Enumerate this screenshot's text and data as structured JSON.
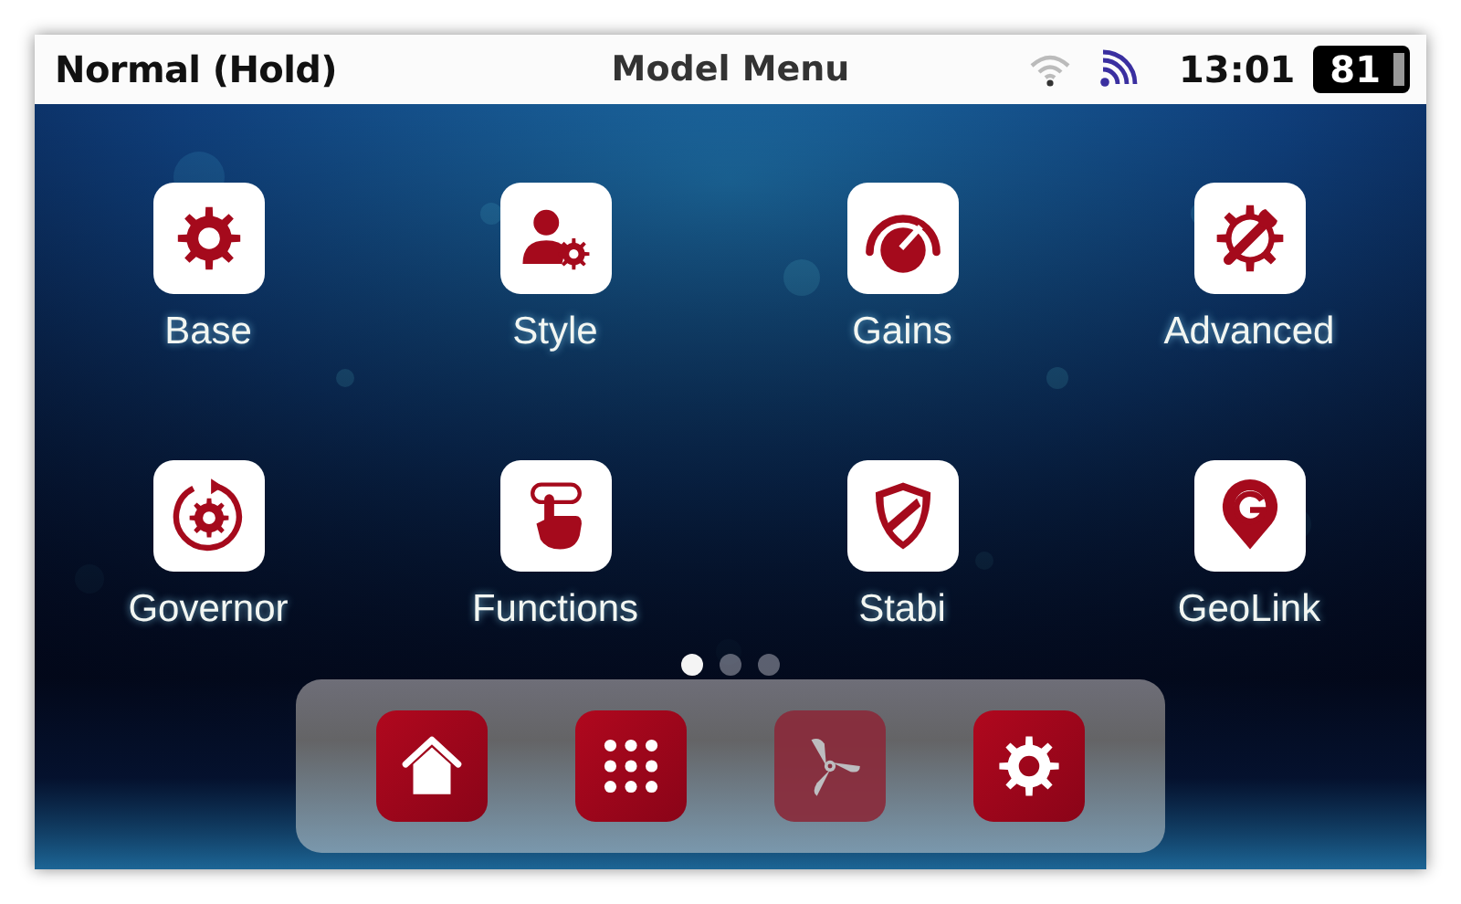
{
  "status_bar": {
    "mode": "Normal (Hold)",
    "title": "Model Menu",
    "time": "13:01",
    "battery": "81"
  },
  "apps": [
    {
      "label": "Base",
      "kind": "gear"
    },
    {
      "label": "Style",
      "kind": "user-gear"
    },
    {
      "label": "Gains",
      "kind": "gauge"
    },
    {
      "label": "Advanced",
      "kind": "gear-wrench"
    },
    {
      "label": "Governor",
      "kind": "cycle-gear"
    },
    {
      "label": "Functions",
      "kind": "hand"
    },
    {
      "label": "Stabi",
      "kind": "shield"
    },
    {
      "label": "GeoLink",
      "kind": "pin"
    }
  ],
  "page_dots": [
    {
      "selected": true
    },
    {
      "selected": false
    },
    {
      "selected": false
    }
  ],
  "dock": [
    {
      "kind": "home",
      "disabled": false
    },
    {
      "kind": "apps",
      "disabled": false
    },
    {
      "kind": "fan",
      "disabled": true
    },
    {
      "kind": "settings",
      "disabled": false
    }
  ]
}
